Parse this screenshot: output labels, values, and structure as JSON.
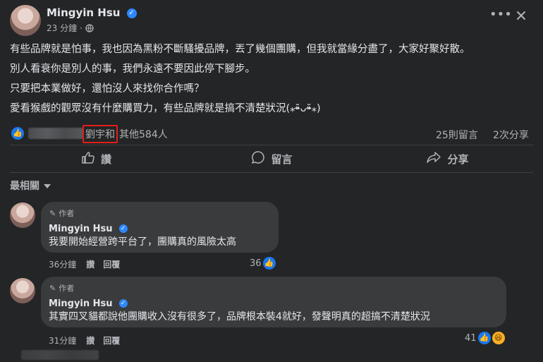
{
  "post": {
    "author": "Mingyin Hsu",
    "time": "23 分鐘",
    "dot": "·",
    "privacy_icon": "globe-icon",
    "more_icon": "more-horizontal-icon",
    "close_icon": "close-icon",
    "lines": [
      "有些品牌就是怕事，我也因為黑粉不斷騷擾品牌，丟了幾個團購，但我就當緣分盡了，大家好聚好散。",
      "別人看衰你是別人的事，我們永遠不要因此停下腳步。",
      "只要把本業做好，還怕沒人來找你合作嗎？",
      "愛看猴戲的觀眾沒有什麼購買力，有些品牌就是搞不清楚狀況(⁎⁍̴̆ᴗ⁍̴̆⁎)"
    ]
  },
  "reactions": {
    "highlighted_name": "劉宇和",
    "others": "其他584人",
    "comments": "25則留言",
    "shares": "2次分享"
  },
  "actions": {
    "like": "讚",
    "comment": "留言",
    "share": "分享"
  },
  "sort": {
    "label": "最相關"
  },
  "comments": [
    {
      "author_tag": "作者",
      "author": "Mingyin Hsu",
      "text": "我要開始經營跨平台了，團購真的風險太高",
      "time": "36分鐘",
      "like": "讚",
      "reply": "回覆",
      "reaction_count": "36"
    },
    {
      "author_tag": "作者",
      "author": "Mingyin Hsu",
      "text": "其實四叉貓都說他團購收入沒有很多了，品牌根本裝4就好，發聲明真的超搞不清楚狀況",
      "time": "31分鐘",
      "like": "讚",
      "reply": "回覆",
      "reaction_count": "41"
    }
  ],
  "colors": {
    "background": "#242526",
    "bubble": "#3a3b3c",
    "accent": "#1877f2",
    "highlight_border": "#e41e1e"
  }
}
